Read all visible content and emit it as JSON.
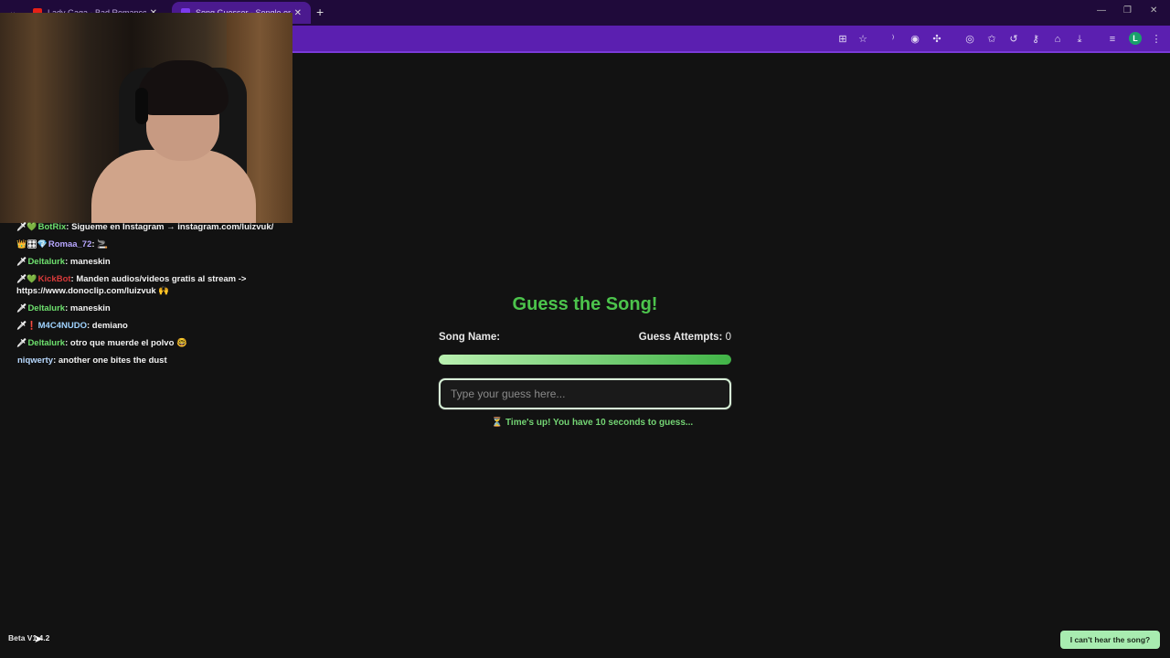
{
  "browser": {
    "tabs": [
      {
        "title": "Lady Gaga - Bad Romance (Offi",
        "favicon_color": "#e62117",
        "active": false
      },
      {
        "title": "Song Guesser - Songle.org",
        "favicon_color": "#7c3aed",
        "active": true
      }
    ],
    "new_tab": "+",
    "close": "✕",
    "window_controls": [
      "—",
      "❐",
      "✕"
    ],
    "toolbar_icons": [
      "translate-icon",
      "star-icon",
      "sound-icon",
      "vpn-icon",
      "extensions-icon",
      "screenshot-icon",
      "bookmark-star-icon",
      "history-icon",
      "password-icon",
      "incognito-icon",
      "download-icon",
      "queue-icon",
      "profile-avatar",
      "menu-icon"
    ],
    "profile_initial": "L"
  },
  "chat": {
    "messages": [
      {
        "badges": "🗡💚",
        "user": "BotRix",
        "user_color": "green",
        "text": "Sigueme en Instagram → instagram.com/luizvuk/"
      },
      {
        "badges": "👑🎛💎",
        "user": "Romaa_72",
        "user_color": "purple",
        "text": "🚬"
      },
      {
        "badges": "🗡",
        "user": "Deltalurk",
        "user_color": "green",
        "text": "maneskin"
      },
      {
        "badges": "🗡💚",
        "user": "KickBot",
        "user_color": "red",
        "text": "Manden audios/videos gratis al stream -> https://www.donoclip.com/luizvuk 🙌"
      },
      {
        "badges": "🗡",
        "user": "Deltalurk",
        "user_color": "green",
        "text": "maneskin"
      },
      {
        "badges": "🗡❗",
        "user": "M4C4NUDO",
        "user_color": "blue",
        "text": "demiano"
      },
      {
        "badges": "🗡",
        "user": "Deltalurk",
        "user_color": "green",
        "text": "otro que muerde el polvo 🤓"
      },
      {
        "badges": "",
        "user": "niqwerty",
        "user_color": "plain",
        "text": "another one bites the dust"
      }
    ]
  },
  "game": {
    "title": "Guess the Song!",
    "song_name_label": "Song Name:",
    "attempts_label": "Guess Attempts:",
    "attempts_value": "0",
    "progress_fraction": 1.0,
    "guess_placeholder": "Type your guess here...",
    "guess_value": "",
    "time_up_text": "⏳ Time's up! You have 10 seconds to guess..."
  },
  "footer": {
    "version": "Beta V1.4.2",
    "cant_hear_button": "I can't hear the song?"
  },
  "colors": {
    "accent_green": "#4cc44c",
    "toolbar_purple": "#5b1fb0",
    "button_green": "#a8ecb0"
  }
}
